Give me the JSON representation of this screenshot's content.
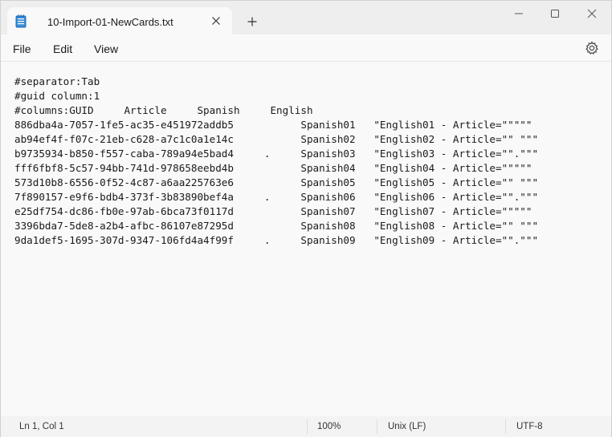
{
  "window": {
    "tab_title": "10-Import-01-NewCards.txt",
    "icons": {
      "app": "notepad-icon",
      "tab_close": "close-icon",
      "new_tab": "plus-icon",
      "minimize": "minimize-icon",
      "maximize": "maximize-icon",
      "close": "close-icon"
    }
  },
  "menu": {
    "file": "File",
    "edit": "Edit",
    "view": "View",
    "settings_icon": "gear-icon"
  },
  "editor": {
    "lines": [
      "#separator:Tab",
      "#guid column:1",
      "#columns:GUID     Article     Spanish     English",
      "886dba4a-7057-1fe5-ac35-e451972addb5           Spanish01   \"English01 - Article=\"\"\"\"\"",
      "ab94ef4f-f07c-21eb-c628-a7c1c0a1e14c           Spanish02   \"English02 - Article=\"\" \"\"\"",
      "b9735934-b850-f557-caba-789a94e5bad4     .     Spanish03   \"English03 - Article=\"\".\"\"\"",
      "fff6fbf8-5c57-94bb-741d-978658eebd4b           Spanish04   \"English04 - Article=\"\"\"\"\"",
      "573d10b8-6556-0f52-4c87-a6aa225763e6           Spanish05   \"English05 - Article=\"\" \"\"\"",
      "7f890157-e9f6-bdb4-373f-3b83890bef4a     .     Spanish06   \"English06 - Article=\"\".\"\"\"",
      "e25df754-dc86-fb0e-97ab-6bca73f0117d           Spanish07   \"English07 - Article=\"\"\"\"\"",
      "3396bda7-5de8-a2b4-afbc-86107e87295d           Spanish08   \"English08 - Article=\"\" \"\"\"",
      "9da1def5-1695-307d-9347-106fd4a4f99f     .     Spanish09   \"English09 - Article=\"\".\"\"\""
    ]
  },
  "status": {
    "position": "Ln 1, Col 1",
    "zoom": "100%",
    "line_ending": "Unix (LF)",
    "encoding": "UTF-8"
  }
}
